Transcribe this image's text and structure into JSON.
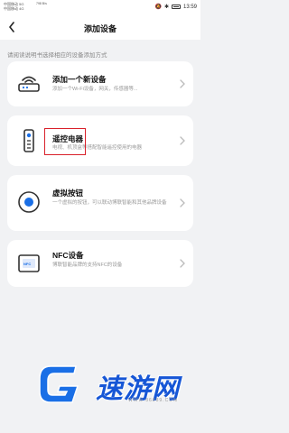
{
  "status_bar": {
    "carrier1": "中国移动 5G",
    "carrier2": "中国移动 4G",
    "net_speed": "798 B/s",
    "time": "13:59"
  },
  "header": {
    "title": "添加设备"
  },
  "hint": "请阅读说明书选择相应的设备添加方式",
  "cards": [
    {
      "title": "添加一个新设备",
      "desc": "添加一个Wi-Fi设备，网关，传感器等..."
    },
    {
      "title": "遥控电器",
      "desc": "电视、机顶盒等搭配智能遥控使用的电器"
    },
    {
      "title": "虚拟按钮",
      "desc": "一个虚拟的按钮，可以联动博联智能和其他品牌设备"
    },
    {
      "title": "NFC设备",
      "desc": "博联智能品牌的支持NFC的设备"
    }
  ],
  "icons": {
    "nfc_label": "NFC"
  },
  "watermark": {
    "text": "速游网",
    "url": "WWW.86889.COM"
  },
  "colors": {
    "accent": "#1a6fe6",
    "highlight": "#d9202a",
    "background": "#f1f2f4"
  }
}
